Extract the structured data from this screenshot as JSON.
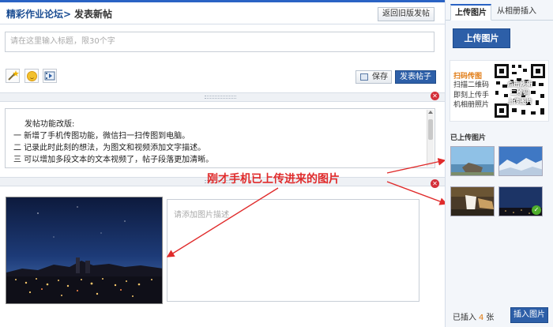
{
  "header": {
    "forum_link": "精彩作业论坛>",
    "page_title": "发表新帖",
    "old_version_button": "返回旧版发帖"
  },
  "title_input": {
    "placeholder": "请在这里输入标题，限30个字"
  },
  "toolbar": {
    "tools": [
      "magic-wand-icon",
      "emoji-icon",
      "video-icon"
    ],
    "save_label": "保存",
    "publish_label": "发表帖子"
  },
  "content": {
    "lines": [
      "发帖功能改版:",
      "一  新增了手机传图功能，微信扫一扫传图到电脑。",
      "二  记录此时此刻的想法，为图文和视频添加文字描述。",
      "三  可以增加多段文本的文本视频了，帖子段落更加清晰。"
    ]
  },
  "photo_block": {
    "caption_placeholder": "请添加图片描述"
  },
  "annotation": "刚才手机已上传进来的图片",
  "sidebar": {
    "tabs": [
      "上传图片",
      "从相册插入"
    ],
    "active_tab": "上传图片",
    "upload_button": "上传图片",
    "qr": {
      "title": "扫码传图",
      "desc_lines": [
        "扫描二维码",
        "即刻上传手",
        "机相册照片"
      ],
      "overlay_lines": [
        "点击刷新",
        "二维码",
        "上传图片"
      ]
    },
    "uploaded_label": "已上传图片",
    "thumbnails": [
      {
        "name": "coast-thumb",
        "selected": false
      },
      {
        "name": "snow-thumb",
        "selected": false
      },
      {
        "name": "waterfall-thumb",
        "selected": false
      },
      {
        "name": "night-city-thumb",
        "selected": true
      }
    ],
    "inserted": {
      "prefix": "已插入",
      "count": "4",
      "suffix": "张"
    },
    "insert_button": "插入图片"
  },
  "colors": {
    "brand_blue": "#2d5fa8",
    "link_blue": "#1b4d93",
    "annotation_red": "#e02b2b",
    "qr_orange": "#e07a12"
  }
}
